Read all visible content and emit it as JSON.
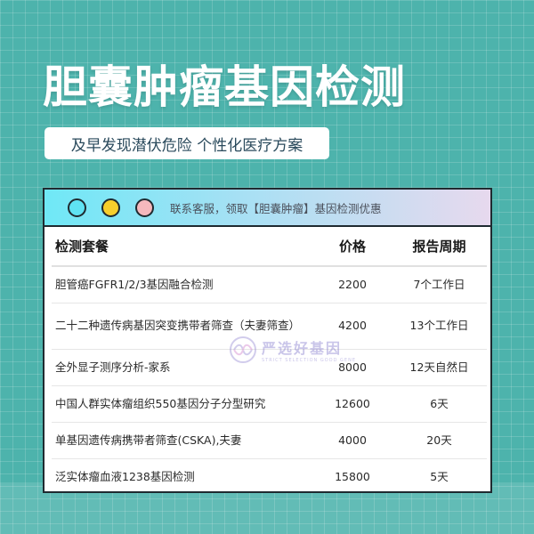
{
  "title": "胆囊肿瘤基因检测",
  "subtitle": "及早发现潜伏危险 个性化医疗方案",
  "card": {
    "header_text": "联系客服，领取【胆囊肿瘤】基因检测优惠",
    "columns": [
      "检测套餐",
      "价格",
      "报告周期"
    ],
    "rows": [
      {
        "name": "胆管癌FGFR1/2/3基因融合检测",
        "price": "2200",
        "cycle": "7个工作日"
      },
      {
        "name": "二十二种遗传病基因突变携带者筛查（夫妻筛查）",
        "price": "4200",
        "cycle": "13个工作日"
      },
      {
        "name": "全外显子测序分析-家系",
        "price": "8000",
        "cycle": "12天自然日"
      },
      {
        "name": "中国人群实体瘤组织550基因分子分型研究",
        "price": "12600",
        "cycle": "6天"
      },
      {
        "name": "单基因遗传病携带者筛查(CSKA),夫妻",
        "price": "4000",
        "cycle": "20天"
      },
      {
        "name": "泛实体瘤血液1238基因检测",
        "price": "15800",
        "cycle": "5天"
      }
    ]
  },
  "watermark": {
    "text": "严选好基因",
    "subtext": "STRICT SELECTION GOOD GENE"
  },
  "colors": {
    "background": "#4db3ac",
    "dot_cyan": "#5fe3f3",
    "dot_yellow": "#f7cf2c",
    "dot_pink": "#f5b8bd"
  }
}
